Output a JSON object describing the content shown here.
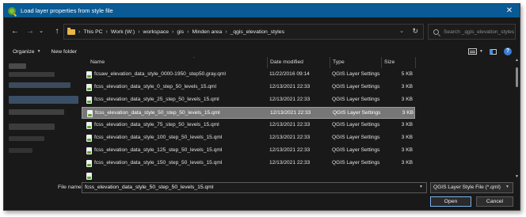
{
  "window": {
    "title": "Load layer properties from style file",
    "close_glyph": "✕"
  },
  "nav": {
    "back_glyph": "←",
    "forward_glyph": "→",
    "recent_glyph": "⌄",
    "up_glyph": "↑"
  },
  "address": {
    "breadcrumbs": [
      "This PC",
      "Work (W:)",
      "workspace",
      "gis",
      "Minden area",
      "_qgis_elevation_styles"
    ],
    "separator": "›",
    "dropdown_glyph": "⌄",
    "refresh_glyph": "↻"
  },
  "search": {
    "placeholder": "Search _qgis_elevation_styles"
  },
  "toolbar": {
    "organize_label": "Organize",
    "new_folder_label": "New folder",
    "help_glyph": "?"
  },
  "columns": {
    "name": "Name",
    "date": "Date modified",
    "type": "Type",
    "size": "Size"
  },
  "files": [
    {
      "name": "fcsaw_elevation_data_style_0000-1950_step50.gray.qml",
      "date": "11/22/2016 09:14",
      "type": "QGIS Layer Settings",
      "size": "5 KB",
      "selected": false
    },
    {
      "name": "fcss_elevation_data_style_0_step_50_levels_15.qml",
      "date": "12/13/2021 22:33",
      "type": "QGIS Layer Settings",
      "size": "3 KB",
      "selected": false
    },
    {
      "name": "fcss_elevation_data_style_25_step_50_levels_15.qml",
      "date": "12/13/2021 22:33",
      "type": "QGIS Layer Settings",
      "size": "3 KB",
      "selected": false
    },
    {
      "name": "fcss_elevation_data_style_50_step_50_levels_15.qml",
      "date": "12/13/2021 22:33",
      "type": "QGIS Layer Settings",
      "size": "3 KB",
      "selected": true
    },
    {
      "name": "fcss_elevation_data_style_75_step_50_levels_15.qml",
      "date": "12/13/2021 22:33",
      "type": "QGIS Layer Settings",
      "size": "3 KB",
      "selected": false
    },
    {
      "name": "fcss_elevation_data_style_100_step_50_levels_15.qml",
      "date": "12/13/2021 22:33",
      "type": "QGIS Layer Settings",
      "size": "3 KB",
      "selected": false
    },
    {
      "name": "fcss_elevation_data_style_125_step_50_levels_15.qml",
      "date": "12/13/2021 22:33",
      "type": "QGIS Layer Settings",
      "size": "3 KB",
      "selected": false
    },
    {
      "name": "fcss_elevation_data_style_150_step_50_levels_15.qml",
      "date": "12/13/2021 22:33",
      "type": "QGIS Layer Settings",
      "size": "3 KB",
      "selected": false
    }
  ],
  "bottom": {
    "file_name_label": "File name:",
    "file_name_value": "fcss_elevation_data_style_50_step_50_levels_15.qml",
    "file_type_value": "QGIS Layer Style File (*.qml)",
    "open_label": "Open",
    "cancel_label": "Cancel"
  },
  "colors": {
    "titlebar": "#0a5a95",
    "background": "#191919",
    "selection": "#777777",
    "folder": "#e8b84a",
    "accent": "#7ab0e8"
  }
}
